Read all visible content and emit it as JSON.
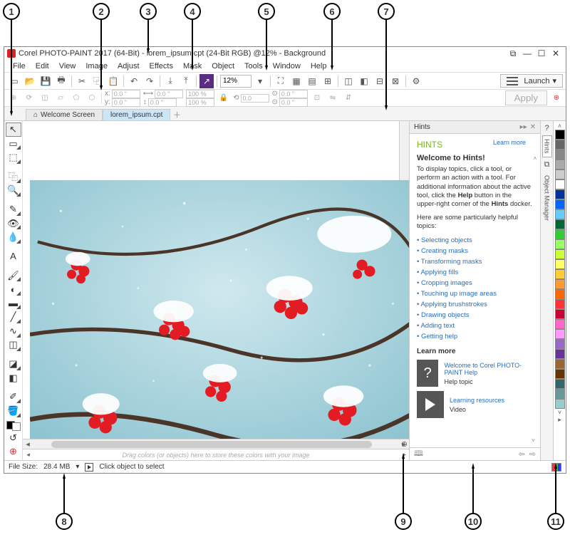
{
  "callouts": [
    "1",
    "2",
    "3",
    "4",
    "5",
    "6",
    "7",
    "8",
    "9",
    "10",
    "11"
  ],
  "titlebar": {
    "title": "Corel PHOTO-PAINT 2017 (64-Bit) - lorem_ipsum.cpt (24-Bit RGB) @12% - Background"
  },
  "menubar": {
    "items": [
      "File",
      "Edit",
      "View",
      "Image",
      "Adjust",
      "Effects",
      "Mask",
      "Object",
      "Tools",
      "Window",
      "Help"
    ]
  },
  "toolbar": {
    "zoom_value": "12%",
    "launch_label": "Launch"
  },
  "propbar": {
    "x": "0.0 \"",
    "y": "0.0 \"",
    "w": "0.0 \"",
    "h": "0.0 \"",
    "sx": "100 %",
    "sy": "100 %",
    "r": "0.0",
    "ox": "0.0 \"",
    "oy": "0.0 \"",
    "apply_label": "Apply"
  },
  "tabs": {
    "welcome": "Welcome Screen",
    "doc": "lorem_ipsum.cpt"
  },
  "color_tray_hint": "Drag colors (or objects) here to store these colors with your image",
  "hints": {
    "docker_title": "Hints",
    "heading": "HINTS",
    "learn_more": "Learn more",
    "welcome": "Welcome to Hints!",
    "intro1": "To display topics, click a tool, or perform an action with a tool. For additional information about the active tool, click the ",
    "intro_bold": "Help",
    "intro2": " button in the upper-right corner of the ",
    "intro_bold2": "Hints",
    "intro3": " docker.",
    "topics_lead": "Here are some particularly helpful topics:",
    "topics": [
      "Selecting objects",
      "Creating masks",
      "Transforming masks",
      "Applying fills",
      "Cropping images",
      "Touching up image areas",
      "Applying brushstrokes",
      "Drawing objects",
      "Adding text",
      "Getting help"
    ],
    "learn_more_heading": "Learn more",
    "lm1_title": "Welcome to Corel PHOTO-PAINT Help",
    "lm1_sub": "Help topic",
    "lm2_title": "Learning resources",
    "lm2_sub": "Video"
  },
  "docker_tabs": {
    "hints": "Hints",
    "object_manager": "Object Manager"
  },
  "statusbar": {
    "filesize_label": "File Size:",
    "filesize_value": "28.4 MB",
    "hint": "Click object to select"
  },
  "palette_colors": [
    "#000000",
    "#666666",
    "#888888",
    "#aaaaaa",
    "#cccccc",
    "#ffffff",
    "#003399",
    "#0066ff",
    "#66ccff",
    "#006633",
    "#33cc33",
    "#99ff66",
    "#ccff33",
    "#ffff66",
    "#ffcc33",
    "#ff9933",
    "#ff6600",
    "#ff3333",
    "#cc0033",
    "#ff66cc",
    "#ff99ff",
    "#9966cc",
    "#663399",
    "#996633",
    "#663300",
    "#336666",
    "#669999",
    "#99cccc"
  ]
}
